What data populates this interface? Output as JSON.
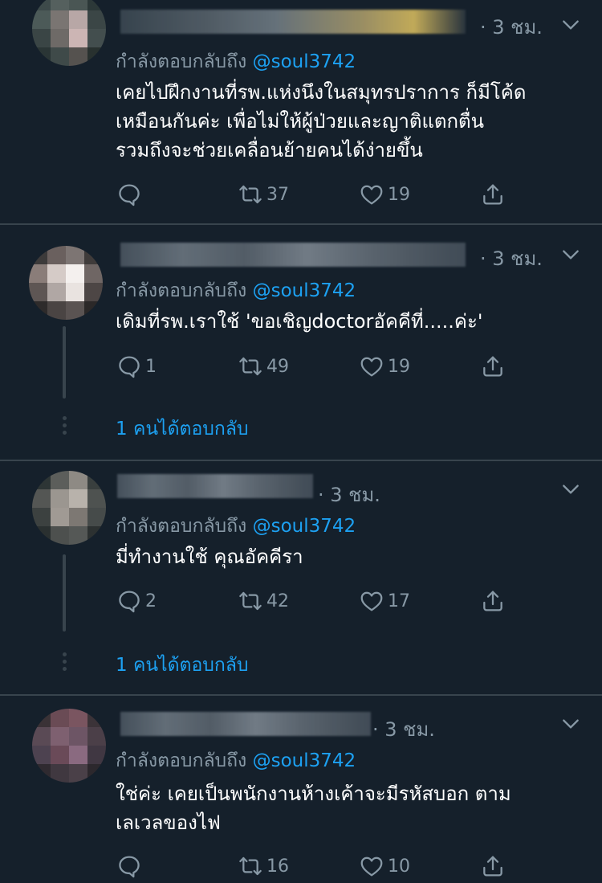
{
  "colors": {
    "background": "#15202b",
    "divider": "#38444d",
    "text_primary": "#ffffff",
    "text_secondary": "#8899a6",
    "accent": "#1da1f2"
  },
  "tweets": [
    {
      "time": "· 3 ชม.",
      "reply_prefix": "กำลังตอบกลับถึง",
      "reply_handle": "@soul3742",
      "body_lines": [
        "เคยไปฝึกงานที่รพ.แห่งนึงในสมุทรปราการ ก็มีโค้ด",
        "เหมือนกันค่ะ เพื่อไม่ให้ผู้ป่วยและญาติแตกตื่น",
        "รวมถึงจะช่วยเคลื่อนย้ายคนได้ง่ายขึ้น"
      ],
      "replies": "",
      "retweets": "37",
      "likes": "19"
    },
    {
      "time": "· 3 ชม.",
      "reply_prefix": "กำลังตอบกลับถึง",
      "reply_handle": "@soul3742",
      "body_lines": [
        "เดิมที่รพ.เราใช้ 'ขอเชิญdoctorอัคคีที่.....ค่ะ'"
      ],
      "replies": "1",
      "retweets": "49",
      "likes": "19",
      "more_replies": "1 คนได้ตอบกลับ"
    },
    {
      "time": "· 3 ชม.",
      "reply_prefix": "กำลังตอบกลับถึง",
      "reply_handle": "@soul3742",
      "body_lines": [
        "มี่ทำงานใช้ คุณอัคคีรา"
      ],
      "replies": "2",
      "retweets": "42",
      "likes": "17",
      "more_replies": "1 คนได้ตอบกลับ"
    },
    {
      "time": "· 3 ชม.",
      "reply_prefix": "กำลังตอบกลับถึง",
      "reply_handle": "@soul3742",
      "body_lines": [
        "ใช่ค่ะ เคยเป็นพนักงานห้างเค้าจะมีรหัสบอก ตาม",
        "เลเวลของไฟ"
      ],
      "replies": "",
      "retweets": "16",
      "likes": "10"
    }
  ]
}
